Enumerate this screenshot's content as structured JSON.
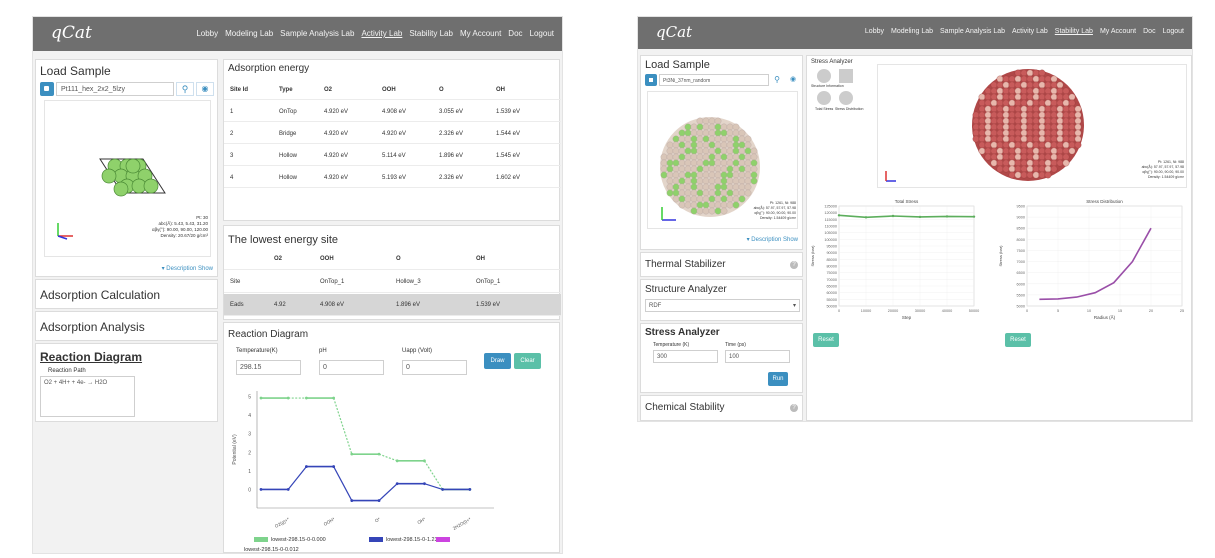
{
  "left_app": {
    "logo": "qCat",
    "nav": [
      "Lobby",
      "Modeling Lab",
      "Sample Analysis Lab",
      "Activity Lab",
      "Stability Lab",
      "My Account",
      "Doc",
      "Logout"
    ],
    "active_nav": "Activity Lab",
    "load_sample": {
      "title": "Load Sample",
      "sample_value": "Pt111_hex_2x2_5lzy",
      "info_lines": [
        "Pt: 30",
        "abc(Å): 5.43, 5.43, 31.20",
        "αβγ(°): 90.00, 90.00, 120.00",
        "Density: 20.67/20 g/cm³"
      ],
      "description_toggle": "▾ Description Show"
    },
    "adsorption_calculation": "Adsorption Calculation",
    "adsorption_analysis": "Adsorption Analysis",
    "reaction_diagram_link": "Reaction Diagram",
    "reaction_path_label": "Reaction Path",
    "reaction_path_value": "O2 + 4H+ + 4e- → H2O",
    "adsorption_energy": {
      "title": "Adsorption energy",
      "headers": [
        "Site Id",
        "Type",
        "O2",
        "OOH",
        "O",
        "OH"
      ],
      "rows": [
        [
          "1",
          "OnTop",
          "4.920 eV",
          "4.908 eV",
          "3.055 eV",
          "1.539 eV"
        ],
        [
          "2",
          "Bridge",
          "4.920 eV",
          "4.920 eV",
          "2.326 eV",
          "1.544 eV"
        ],
        [
          "3",
          "Hollow",
          "4.920 eV",
          "5.114 eV",
          "1.896 eV",
          "1.545 eV"
        ],
        [
          "4",
          "Hollow",
          "4.920 eV",
          "5.193 eV",
          "2.326 eV",
          "1.602 eV"
        ]
      ]
    },
    "lowest_energy": {
      "title": "The lowest energy site",
      "headers": [
        "",
        "O2",
        "OOH",
        "O",
        "OH"
      ],
      "site_row": [
        "Site",
        "",
        "OnTop_1",
        "Hollow_3",
        "OnTop_1"
      ],
      "energy_row": [
        "Eads",
        "4.92",
        "4.908 eV",
        "1.896 eV",
        "1.539 eV"
      ]
    },
    "reaction_diagram": {
      "title": "Reaction Diagram",
      "temperature_label": "Temperature(K)",
      "temperature_value": "298.15",
      "ph_label": "pH",
      "ph_value": "0",
      "u_label": "Uapp (Volt)",
      "u_value": "0",
      "draw_button": "Draw",
      "clear_button": "Clear"
    }
  },
  "chart_data": [
    {
      "type": "line",
      "title": "",
      "ylabel": "Potential (eV)",
      "categories": [
        "O2(g)+*",
        "OOH*",
        "O*",
        "OH*",
        "2H2O(l)+*"
      ],
      "ylim": [
        0,
        5
      ],
      "series": [
        {
          "name": "lowest-298.15-0-0.000",
          "color": "#7ed38c",
          "values": [
            4.92,
            4.92,
            1.9,
            1.54,
            0
          ]
        },
        {
          "name": "lowest-298.15-0-1.230",
          "color": "#3545b8",
          "values": [
            0,
            1.23,
            -0.6,
            0.31,
            0
          ]
        },
        {
          "name": "lowest-298.15-0-0.012",
          "color": "#cc44e0",
          "values": []
        }
      ]
    },
    {
      "type": "line",
      "title": "Total Stress",
      "xlabel": "Step",
      "ylabel": "Stress (bar)",
      "x_ticks": [
        "0",
        "10000",
        "20000",
        "30000",
        "40000",
        "50000"
      ],
      "y_ticks": [
        "50000",
        "55000",
        "60000",
        "65000",
        "70000",
        "75000",
        "80000",
        "85000",
        "90000",
        "95000",
        "100000",
        "105000",
        "110000",
        "115000",
        "120000",
        "125000"
      ],
      "ylim": [
        50000,
        125000
      ],
      "series": [
        {
          "name": "",
          "color": "#5cae5c",
          "x": [
            0,
            10000,
            20000,
            30000,
            40000,
            50000
          ],
          "values": [
            118000,
            116500,
            117500,
            116800,
            117200,
            117000
          ]
        }
      ]
    },
    {
      "type": "line",
      "title": "Stress Distribution",
      "xlabel": "Radius (Å)",
      "ylabel": "Stress (bar)",
      "x_ticks": [
        "0",
        "5",
        "10",
        "15",
        "20",
        "25"
      ],
      "y_ticks": [
        "5000",
        "5500",
        "6000",
        "6500",
        "7000",
        "7500",
        "8000",
        "8500",
        "9000",
        "9500"
      ],
      "ylim": [
        5000,
        9500
      ],
      "series": [
        {
          "name": "",
          "color": "#9a4fa8",
          "x": [
            2,
            5,
            8,
            11,
            14,
            17,
            20
          ],
          "values": [
            5300,
            5320,
            5400,
            5600,
            6050,
            7000,
            8500
          ]
        }
      ]
    }
  ],
  "right_app": {
    "logo": "qCat",
    "nav": [
      "Lobby",
      "Modeling Lab",
      "Sample Analysis Lab",
      "Activity Lab",
      "Stability Lab",
      "My Account",
      "Doc",
      "Logout"
    ],
    "active_nav": "Stability Lab",
    "load_sample": {
      "title": "Load Sample",
      "sample_value": "Pt3Ni_37nm_random",
      "info_lines": [
        "Pt: 1261, Ni: 988",
        "abc(Å): 57.97, 57.97, 57.98",
        "αβγ(°): 90.00, 90.00, 90.00",
        "Density: 1.54409 g/cm³"
      ],
      "description_toggle": "▾ Description Show"
    },
    "thermal_stabilizer": "Thermal Stabilizer",
    "structure_analyzer": "Structure Analyzer",
    "structure_select": "RDF",
    "stress_analyzer": "Stress Analyzer",
    "temperature_label": "Temperature (K)",
    "temperature_value": "300",
    "time_label": "Time (ps)",
    "time_value": "100",
    "run_button": "Run",
    "chemical_stability": "Chemical Stability",
    "stress_panel_label": "Stress Analyzer",
    "stress_icon_labels": [
      "Structure Information",
      "Total Stress",
      "Stress Distribution"
    ],
    "viewer_info_lines": [
      "Pt: 1261, Ni: 988",
      "abc(Å): 57.97, 57.97, 57.98",
      "αβγ(°): 90.00, 90.00, 90.00",
      "Density: 1.54409 g/cm³"
    ],
    "reset_button": "Reset",
    "reset_button_2": "Reset"
  },
  "colors": {
    "topbar": "#6f6f6f",
    "teal": "#5bc0a8",
    "blue": "#3b8fc0",
    "pt_sphere": "#d9c6b8",
    "ni_sphere": "#8fd16b",
    "red_sphere": "#c85b5b"
  }
}
